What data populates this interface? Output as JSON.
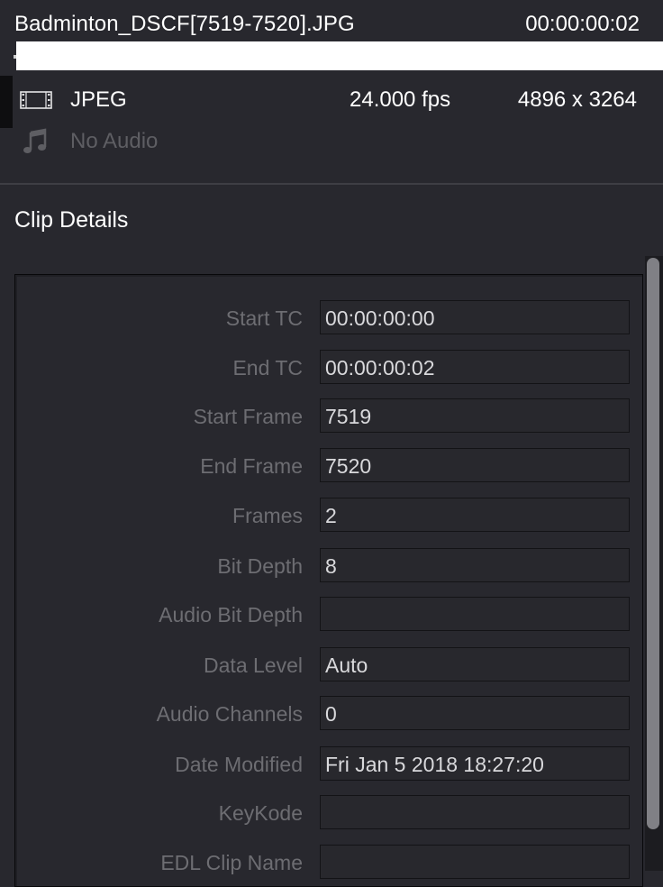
{
  "clip": {
    "name": "Badminton_DSCF[7519-7520].JPG",
    "duration": "00:00:00:02"
  },
  "video": {
    "icon": "film-strip-icon",
    "format": "JPEG",
    "fps": "24.000 fps",
    "resolution": "4896 x 3264"
  },
  "audio": {
    "icon": "music-note-icon",
    "label": "No Audio"
  },
  "section": {
    "title": "Clip Details"
  },
  "details": [
    {
      "label": "Start TC",
      "value": "00:00:00:00"
    },
    {
      "label": "End TC",
      "value": "00:00:00:02"
    },
    {
      "label": "Start Frame",
      "value": "7519"
    },
    {
      "label": "End Frame",
      "value": "7520"
    },
    {
      "label": "Frames",
      "value": "2"
    },
    {
      "label": "Bit Depth",
      "value": "8"
    },
    {
      "label": "Audio Bit Depth",
      "value": ""
    },
    {
      "label": "Data Level",
      "value": "Auto"
    },
    {
      "label": "Audio Channels",
      "value": "0"
    },
    {
      "label": "Date Modified",
      "value": "Fri Jan 5 2018 18:27:20"
    },
    {
      "label": "KeyKode",
      "value": ""
    },
    {
      "label": "EDL Clip Name",
      "value": ""
    }
  ],
  "colors": {
    "background": "#28282e",
    "label_text": "#6d6d72",
    "value_text": "#d9d9dc",
    "disabled_text": "#5e5e63"
  }
}
